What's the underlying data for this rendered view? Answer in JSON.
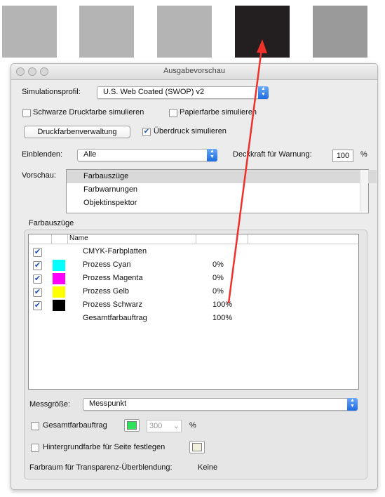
{
  "swatches": [
    {
      "color": "#b4b4b4"
    },
    {
      "color": "#b4b4b4"
    },
    {
      "color": "#b4b4b4"
    },
    {
      "color": "#231f20"
    },
    {
      "color": "#9a9a9a"
    }
  ],
  "window": {
    "title": "Ausgabevorschau"
  },
  "simulation": {
    "label": "Simulationsprofil:",
    "profile": "U.S. Web Coated (SWOP) v2",
    "black_ink_label": "Schwarze Druckfarbe simulieren",
    "paper_color_label": "Papierfarbe simulieren",
    "ink_manager_label": "Druckfarbenverwaltung",
    "overprint_label": "Überdruck simulieren",
    "overprint_checked": true
  },
  "show": {
    "label": "Einblenden:",
    "value": "Alle",
    "warning_label": "Deckkraft für Warnung:",
    "warning_value": "100",
    "percent": "%"
  },
  "preview": {
    "label": "Vorschau:",
    "items": [
      "Farbauszüge",
      "Farbwarnungen",
      "Objektinspektor"
    ]
  },
  "separations": {
    "group_label": "Farbauszüge",
    "column_name": "Name",
    "rows": [
      {
        "name": "CMYK-Farbplatten",
        "value": "",
        "checked": true,
        "swatch": ""
      },
      {
        "name": "Prozess Cyan",
        "value": "0%",
        "checked": true,
        "swatch": "#00ffff"
      },
      {
        "name": "Prozess Magenta",
        "value": "0%",
        "checked": true,
        "swatch": "#ff00ff"
      },
      {
        "name": "Prozess Gelb",
        "value": "0%",
        "checked": true,
        "swatch": "#ffff00"
      },
      {
        "name": "Prozess Schwarz",
        "value": "100%",
        "checked": true,
        "swatch": "#000000"
      },
      {
        "name": "Gesamtfarbauftrag",
        "value": "100%",
        "checked": false,
        "swatch": ""
      }
    ]
  },
  "measure": {
    "label": "Messgröße:",
    "value": "Messpunkt"
  },
  "total_ink": {
    "label": "Gesamtfarbauftrag",
    "value": "300",
    "percent": "%",
    "color": "#2ee05a"
  },
  "background": {
    "label": "Hintergrundfarbe für Seite festlegen",
    "color": "#f1efdd"
  },
  "transparency": {
    "label": "Farbraum für Transparenz-Überblendung:",
    "value": "Keine"
  },
  "arrow_color": "#f0302a"
}
